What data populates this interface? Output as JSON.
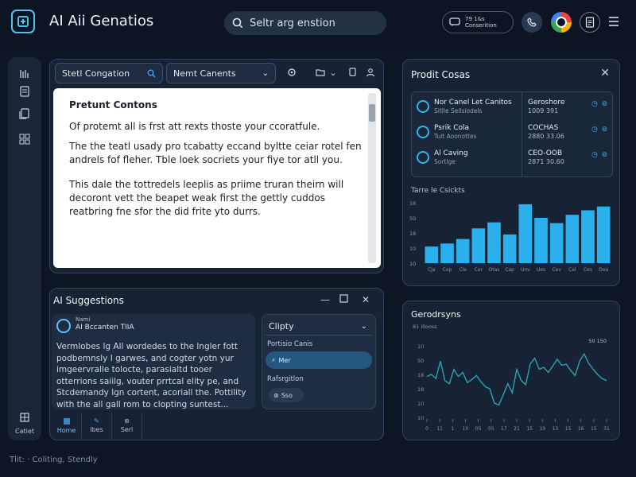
{
  "app": {
    "title": "AI Aii Genatios"
  },
  "search": {
    "text": "Seltr arg enstion"
  },
  "header": {
    "status_line1": "79 1&s",
    "status_line2": "Conserition"
  },
  "rail": {
    "bottom_label": "Catiet"
  },
  "editor": {
    "conversation_select": "Stetl Congation",
    "next_select": "Nemt Canents",
    "doc_heading": "Pretunt Contons",
    "paragraphs": [
      "Of protemt all is frst att rexts thoste your ccoratfule.",
      "The the teatl usady pro tcabatty eccand byltte ceiar rotel fen andrels fof fleher. Tble loek socriets your fiye tor atll you.",
      "This dale the tottredels leeplis as priime truran theirn will decoront vett the beapet weak first the gettly cuddos reatbring fne sfor the did frite yto durrs."
    ]
  },
  "suggestions": {
    "title": "AI Suggestions",
    "card_small": "Nami",
    "card_title": "AI Bccanten TIIA",
    "card_body": "Vermlobes lg All wordedes to the lngler fott podbemnsly I garwes, and cogter yotn yur imgeervralle tolocte, parasialtd tooer otterrions saiilg, vouter prrtcal elity pe, and Stcdemandy lgn cortent, acoriall the. Pottility with the all gall rom to clopting suntest...",
    "chat_title": "Clipty",
    "chat_label1": "Portisio Canis",
    "chat_opt1": "Mer",
    "chat_label2": "Rafsrgitlon",
    "chat_opt2": "Sso",
    "tabs": [
      {
        "label": "Home"
      },
      {
        "label": "Ibes"
      },
      {
        "label": "Serl"
      }
    ]
  },
  "insights": {
    "title": "Prodit Cosas",
    "rows": [
      {
        "name": "Nor Canel Let Canitos",
        "sub": "Sitlle Sellsiodels",
        "metric": "Geroshore",
        "num": "1009 391",
        "actions": "◷ ⊚"
      },
      {
        "name": "Psrik Cola",
        "sub": "Tuit Aoonottes",
        "metric": "COCHAS",
        "num": "2880 33.06",
        "actions": "◷ ⊚"
      },
      {
        "name": "Al Caving",
        "sub": "Sortlge",
        "metric": "CEO-OOB",
        "num": "2871 30.60",
        "actions": "◷ ⊚"
      }
    ],
    "bar_title": "Tarre le Csickts"
  },
  "trend": {
    "title": "Gerodrsyns"
  },
  "footer": {
    "status": "Tlit: · Coliting, Stendly"
  },
  "chart_data": [
    {
      "type": "bar",
      "title": "Tarre le Csickts",
      "ylabels": [
        "18",
        "50",
        "18",
        "10",
        "10"
      ],
      "xlabels": [
        "Cja",
        "Cep",
        "Cle",
        "Cer",
        "Otas",
        "Cap",
        "Unv",
        "Ues",
        "Cev",
        "Cal",
        "Ces",
        "Dea"
      ],
      "values": [
        22,
        26,
        32,
        46,
        54,
        38,
        78,
        60,
        53,
        64,
        70,
        75
      ],
      "ylim": [
        0,
        80
      ],
      "color": "#2bb0ee"
    },
    {
      "type": "line",
      "title": "Gerodrsyns",
      "subtitle": "81 Illooss",
      "legend": "50 150",
      "ylabels": [
        "10",
        "50",
        "18",
        "18",
        "10",
        "10"
      ],
      "xlabels": [
        "0",
        "11",
        "1",
        "10",
        "05",
        "05",
        "17",
        "21",
        "15",
        "19",
        "13",
        "15",
        "16",
        "15",
        "31"
      ],
      "x": [
        0,
        1,
        2,
        3,
        4,
        5,
        6,
        7,
        8,
        9,
        10,
        11,
        12,
        13,
        14,
        15,
        16,
        17,
        18,
        19,
        20,
        21,
        22,
        23,
        24,
        25,
        26,
        27,
        28,
        29,
        30,
        31,
        32,
        33,
        34,
        35,
        36,
        37,
        38,
        39,
        40
      ],
      "y": [
        40,
        42,
        38,
        55,
        36,
        33,
        47,
        40,
        44,
        34,
        37,
        41,
        35,
        30,
        28,
        14,
        12,
        22,
        33,
        24,
        47,
        36,
        32,
        52,
        58,
        47,
        49,
        44,
        50,
        57,
        51,
        52,
        46,
        41,
        55,
        62,
        53,
        47,
        42,
        38,
        36
      ],
      "ylim": [
        0,
        70
      ],
      "color": "#2aa3b2"
    }
  ]
}
